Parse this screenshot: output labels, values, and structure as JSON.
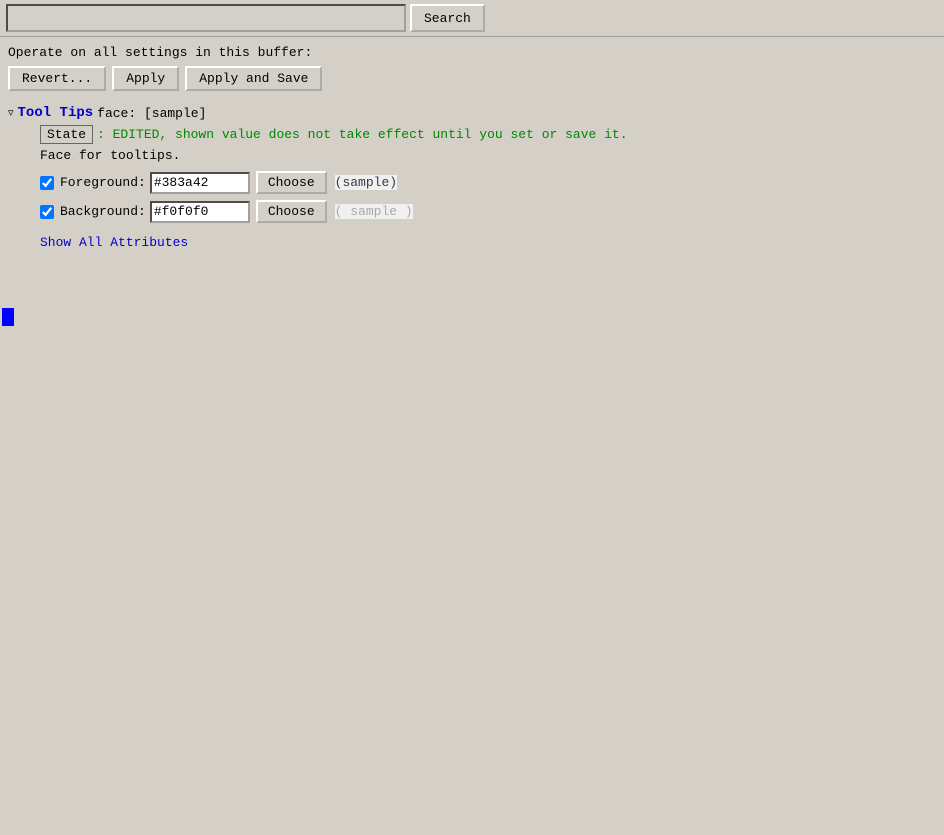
{
  "topbar": {
    "search_placeholder": "",
    "search_button_label": "Search"
  },
  "toolbar": {
    "operate_label": "Operate on all settings in this buffer:",
    "revert_label": "Revert...",
    "apply_label": "Apply",
    "apply_save_label": "Apply and Save"
  },
  "section": {
    "triangle": "▿",
    "title": "Tool Tips",
    "subtitle": "face: [sample]",
    "state_badge": "State",
    "state_description": ": EDITED, shown value does not take effect until you set or save it.",
    "face_description": "Face for tooltips.",
    "foreground_label": "Foreground:",
    "foreground_value": "#383a42",
    "background_label": "Background:",
    "background_value": "#f0f0f0",
    "choose_fg_label": "Choose",
    "choose_bg_label": "Choose",
    "sample_fg": "(sample)",
    "sample_bg": "( sample )",
    "show_all_label": "Show All Attributes"
  },
  "side_markers": [
    "▽",
    "▽",
    "▽",
    "▽",
    "▽",
    "▽",
    "▽",
    "▽",
    "▽",
    "▽",
    "▽",
    "▽",
    "▽",
    "▽",
    "▽",
    "▽",
    "▽",
    "▽",
    "▽",
    "▽",
    "▽",
    "▽",
    "▽",
    "▽",
    "▽"
  ]
}
